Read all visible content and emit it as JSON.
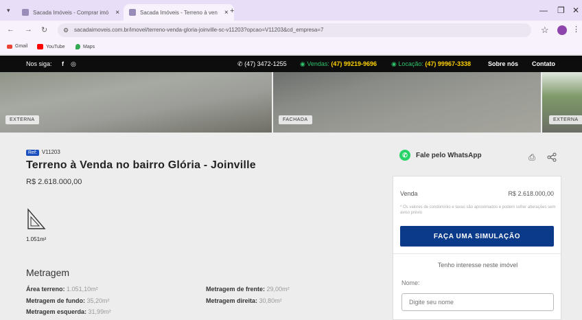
{
  "browser": {
    "tabs": [
      {
        "title": "Sacada Imóveis - Comprar imó"
      },
      {
        "title": "Sacada Imóveis - Terreno à ven"
      }
    ],
    "new_tab": "+",
    "url": "sacadaimoveis.com.br/imovel/terreno-venda-gloria-joinville-sc-v11203?opcao=V11203&cd_empresa=7",
    "bookmarks": [
      "Gmail",
      "YouTube",
      "Maps"
    ]
  },
  "site_nav": {
    "follow_label": "Nos siga:",
    "phone": "(47) 3472-1255",
    "vendas_label": "Vendas:",
    "vendas_phone": "(47) 99219-9696",
    "locacao_label": "Locação:",
    "locacao_phone": "(47) 99967-3338",
    "about": "Sobre nós",
    "contact": "Contato"
  },
  "photos": [
    {
      "tag": "EXTERNA"
    },
    {
      "tag": "FACHADA"
    },
    {
      "tag": "EXTERNA"
    }
  ],
  "property": {
    "ref_label": "Ref:",
    "ref": "V11203",
    "title": "Terreno à Venda no bairro Glória - Joinville",
    "price": "R$ 2.618.000,00",
    "area": "1.051m²",
    "section_title": "Metragem",
    "specs": [
      {
        "label": "Área terreno:",
        "value": "1.051,10m²"
      },
      {
        "label": "Metragem de frente:",
        "value": "29,00m²"
      },
      {
        "label": "Metragem de fundo:",
        "value": "35,20m²"
      },
      {
        "label": "Metragem direita:",
        "value": "30,80m²"
      },
      {
        "label": "Metragem esquerda:",
        "value": "31,99m²"
      }
    ]
  },
  "sidebar": {
    "whatsapp_label": "Fale pelo WhatsApp",
    "sale_label": "Venda",
    "sale_price": "R$ 2.618.000,00",
    "note": "* Os valores de condomínio e taxas são aproximados e podem sofrer alterações sem aviso prévio",
    "simulate_button": "FAÇA UMA SIMULAÇÃO",
    "interest_title": "Tenho interesse neste imóvel",
    "name_label": "Nome:",
    "name_placeholder": "Digite seu nome"
  },
  "colors": {
    "accent_blue": "#0b3a8a",
    "whatsapp_green": "#25d366",
    "nav_green": "#2ec26a",
    "nav_yellow": "#ffd200"
  }
}
